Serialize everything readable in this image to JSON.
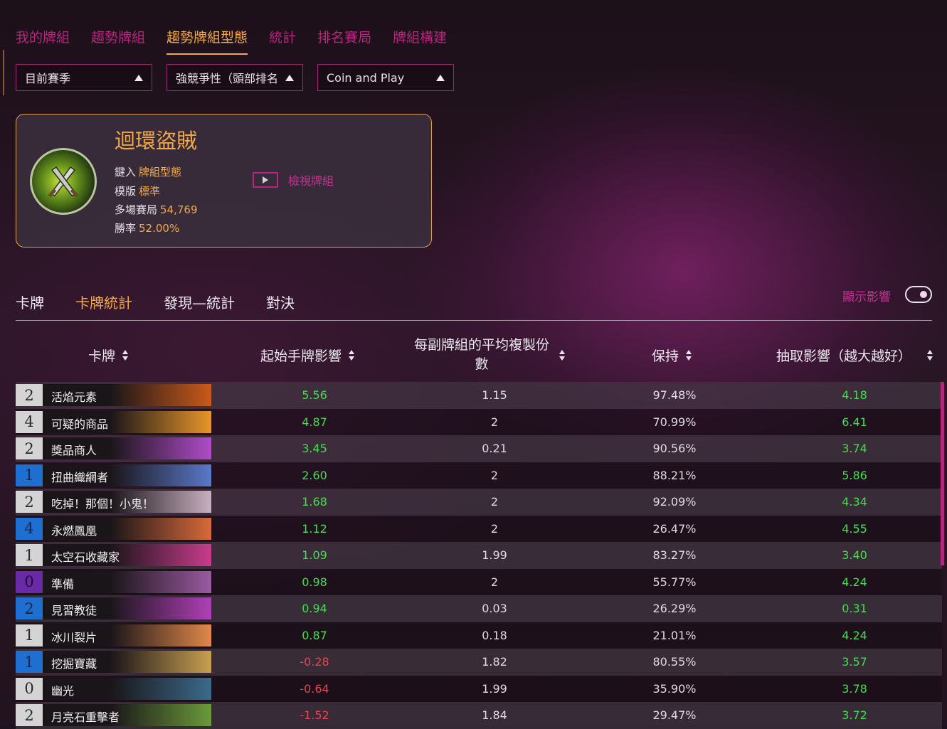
{
  "nav": {
    "tabs": [
      "我的牌組",
      "趨勢牌組",
      "趨勢牌組型態",
      "統計",
      "排名賽局",
      "牌組構建"
    ],
    "active_index": 2
  },
  "filters": [
    {
      "value": "目前賽季"
    },
    {
      "value": "強競爭性（頭部排名"
    },
    {
      "value": "Coin and Play"
    }
  ],
  "deck": {
    "title": "迴環盜賊",
    "meta": [
      {
        "label": "鍵入",
        "value": "牌組型態"
      },
      {
        "label": "模版",
        "value": "標準"
      },
      {
        "label": "多場賽局",
        "value": "54,769"
      },
      {
        "label": "勝率",
        "value": "52.00%"
      }
    ],
    "view_label": "檢視牌組",
    "emblem_icon": "crossed-daggers-icon"
  },
  "subtabs": {
    "items": [
      "卡牌",
      "卡牌統計",
      "發現—統計",
      "對決"
    ],
    "active_index": 1
  },
  "show_impact": {
    "label": "顯示影響",
    "enabled": true
  },
  "table": {
    "headers": [
      "卡牌",
      "起始手牌影響",
      "每副牌組的平均複製份",
      "數",
      "保持",
      "抽取影響（越大越好）"
    ],
    "rows": [
      {
        "cost": "2",
        "rarity": "common",
        "name": "活焰元素",
        "art": "#c95a1a",
        "mulligan": "5.56",
        "copies": "1.15",
        "keep": "97.48%",
        "draw": "4.18"
      },
      {
        "cost": "4",
        "rarity": "common",
        "name": "可疑的商品",
        "art": "#e8962a",
        "mulligan": "4.87",
        "copies": "2",
        "keep": "70.99%",
        "draw": "6.41"
      },
      {
        "cost": "2",
        "rarity": "common",
        "name": "獎品商人",
        "art": "#b04cc8",
        "mulligan": "3.45",
        "copies": "0.21",
        "keep": "90.56%",
        "draw": "3.74"
      },
      {
        "cost": "1",
        "rarity": "rare",
        "name": "扭曲織網者",
        "art": "#5a78c8",
        "mulligan": "2.60",
        "copies": "2",
        "keep": "88.21%",
        "draw": "5.86"
      },
      {
        "cost": "2",
        "rarity": "common",
        "name": "吃掉！那個！小鬼！",
        "art": "#c8b0c0",
        "mulligan": "1.68",
        "copies": "2",
        "keep": "92.09%",
        "draw": "4.34"
      },
      {
        "cost": "4",
        "rarity": "rare",
        "name": "永燃鳳凰",
        "art": "#d86a3a",
        "mulligan": "1.12",
        "copies": "2",
        "keep": "26.47%",
        "draw": "4.55"
      },
      {
        "cost": "1",
        "rarity": "common",
        "name": "太空石收藏家",
        "art": "#c83c8c",
        "mulligan": "1.09",
        "copies": "1.99",
        "keep": "83.27%",
        "draw": "3.40"
      },
      {
        "cost": "0",
        "rarity": "epic",
        "name": "準備",
        "art": "#9a5aa0",
        "mulligan": "0.98",
        "copies": "2",
        "keep": "55.77%",
        "draw": "4.24"
      },
      {
        "cost": "2",
        "rarity": "rare",
        "name": "見習教徒",
        "art": "#b040b8",
        "mulligan": "0.94",
        "copies": "0.03",
        "keep": "26.29%",
        "draw": "0.31"
      },
      {
        "cost": "1",
        "rarity": "common",
        "name": "冰川裂片",
        "art": "#e0884a",
        "mulligan": "0.87",
        "copies": "0.18",
        "keep": "21.01%",
        "draw": "4.24"
      },
      {
        "cost": "1",
        "rarity": "rare",
        "name": "挖掘寶藏",
        "art": "#c8a050",
        "mulligan": "-0.28",
        "copies": "1.82",
        "keep": "80.55%",
        "draw": "3.57"
      },
      {
        "cost": "0",
        "rarity": "leg",
        "name": "幽光",
        "art": "#3a6a8a",
        "mulligan": "-0.64",
        "copies": "1.99",
        "keep": "35.90%",
        "draw": "3.78"
      },
      {
        "cost": "2",
        "rarity": "common",
        "name": "月亮石重擊者",
        "art": "#6a9a3a",
        "mulligan": "-1.52",
        "copies": "1.84",
        "keep": "29.47%",
        "draw": "3.72"
      }
    ]
  },
  "colors": {
    "accent": "#f3a945",
    "magenta": "#b7267e",
    "positive": "#3fe04a",
    "negative": "#e8444e"
  }
}
